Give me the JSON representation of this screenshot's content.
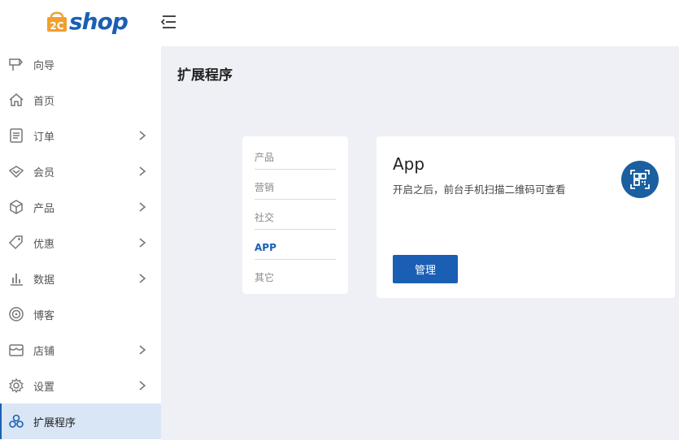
{
  "header": {
    "logo_text": "shop",
    "logo_mark_text": "2C",
    "colors": {
      "brand_blue": "#1a5fb4",
      "logo_orange": "#f0a030"
    }
  },
  "sidebar": {
    "items": [
      {
        "label": "向导",
        "icon": "signpost-icon",
        "has_submenu": false,
        "active": false
      },
      {
        "label": "首页",
        "icon": "home-icon",
        "has_submenu": false,
        "active": false
      },
      {
        "label": "订单",
        "icon": "clipboard-icon",
        "has_submenu": true,
        "active": false
      },
      {
        "label": "会员",
        "icon": "diamond-icon",
        "has_submenu": true,
        "active": false
      },
      {
        "label": "产品",
        "icon": "cube-icon",
        "has_submenu": true,
        "active": false
      },
      {
        "label": "优惠",
        "icon": "tag-icon",
        "has_submenu": true,
        "active": false
      },
      {
        "label": "数据",
        "icon": "bar-chart-icon",
        "has_submenu": true,
        "active": false
      },
      {
        "label": "博客",
        "icon": "target-icon",
        "has_submenu": false,
        "active": false
      },
      {
        "label": "店铺",
        "icon": "store-icon",
        "has_submenu": true,
        "active": false
      },
      {
        "label": "设置",
        "icon": "gear-icon",
        "has_submenu": true,
        "active": false
      },
      {
        "label": "扩展程序",
        "icon": "extensions-icon",
        "has_submenu": false,
        "active": true
      }
    ]
  },
  "main": {
    "title": "扩展程序",
    "categories": [
      {
        "label": "产品",
        "active": false
      },
      {
        "label": "营销",
        "active": false
      },
      {
        "label": "社交",
        "active": false
      },
      {
        "label": "APP",
        "active": true
      },
      {
        "label": "其它",
        "active": false
      }
    ],
    "app_card": {
      "name": "App",
      "description": "开启之后，前台手机扫描二维码可查看",
      "button_label": "管理",
      "icon": "qr-scan-icon"
    }
  }
}
